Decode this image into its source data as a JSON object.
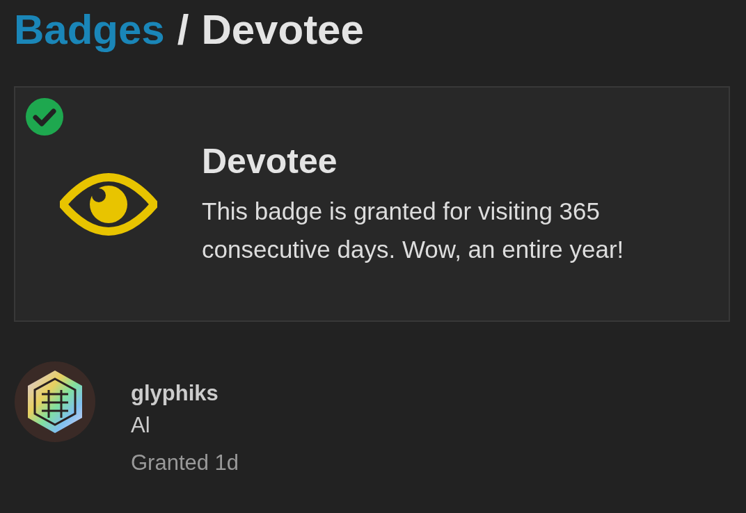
{
  "breadcrumb": {
    "parent": "Badges",
    "separator": "/",
    "current": "Devotee"
  },
  "badge": {
    "granted": true,
    "title": "Devotee",
    "description": "This badge is granted for visiting 365 consecutive days. Wow, an entire year!"
  },
  "grantees": [
    {
      "username": "glyphiks",
      "name": "Al",
      "granted": "Granted 1d"
    }
  ]
}
